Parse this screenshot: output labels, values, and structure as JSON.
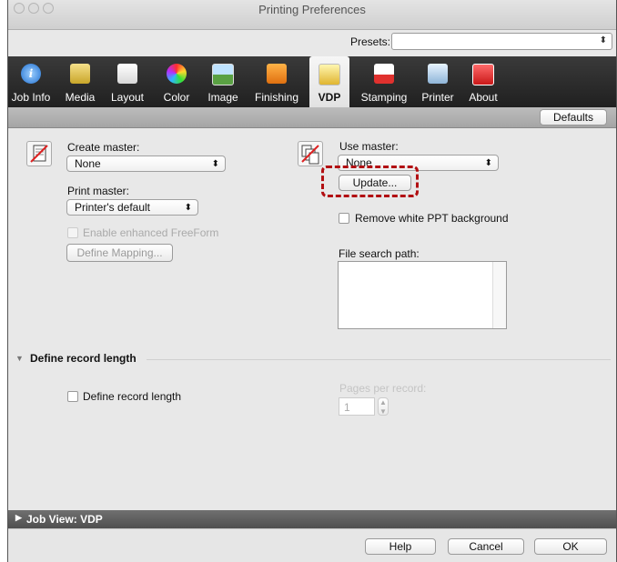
{
  "window": {
    "title": "Printing Preferences"
  },
  "presets": {
    "label": "Presets:",
    "value": ""
  },
  "tabs": [
    {
      "label": "Job Info"
    },
    {
      "label": "Media"
    },
    {
      "label": "Layout"
    },
    {
      "label": "Color"
    },
    {
      "label": "Image"
    },
    {
      "label": "Finishing"
    },
    {
      "label": "VDP"
    },
    {
      "label": "Stamping"
    },
    {
      "label": "Printer"
    },
    {
      "label": "About"
    }
  ],
  "defaults_button": "Defaults",
  "create_master": {
    "label": "Create master:",
    "value": "None"
  },
  "print_master": {
    "label": "Print master:",
    "value": "Printer's default"
  },
  "enable_freeform": "Enable enhanced FreeForm",
  "define_mapping": "Define Mapping...",
  "use_master": {
    "label": "Use master:",
    "value": "None"
  },
  "update_button": "Update...",
  "remove_white_ppt": "Remove white PPT background",
  "file_search_path": {
    "label": "File search path:"
  },
  "record_section": {
    "title": "Define record length"
  },
  "define_record_length_checkbox": "Define record length",
  "pages_per_record": {
    "label": "Pages per record:",
    "value": "1"
  },
  "job_view": "Job View: VDP",
  "footer": {
    "help": "Help",
    "cancel": "Cancel",
    "ok": "OK"
  },
  "colors": {
    "highlight": "#b20f12",
    "toolbar_bg": "#2a2a2a"
  },
  "icons": {
    "tabs": [
      "info-icon",
      "media-icon",
      "layout-icon",
      "color-wheel-icon",
      "image-icon",
      "finishing-icon",
      "vdp-icon",
      "stamping-icon",
      "printer-icon",
      "about-icon"
    ],
    "create_master": "create-master-icon",
    "use_master": "use-master-icon"
  }
}
